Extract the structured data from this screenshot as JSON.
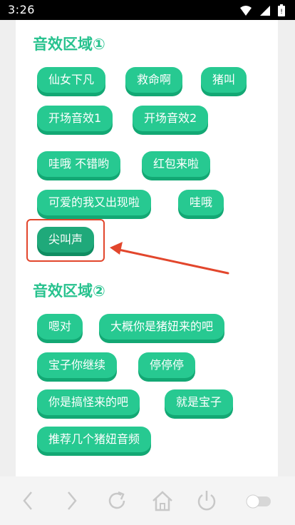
{
  "status_bar": {
    "time": "3:26",
    "icons": [
      "wifi-icon",
      "signal-icon",
      "battery-icon"
    ]
  },
  "sections": [
    {
      "title": "音效区域①",
      "buttons": [
        "仙女下凡",
        "救命啊",
        "猪叫",
        "开场音效1",
        "开场音效2",
        "哇哦 不错哟",
        "红包来啦",
        "可爱的我又出现啦",
        "哇哦",
        "尖叫声"
      ]
    },
    {
      "title": "音效区域②",
      "buttons": [
        "嗯对",
        "大概你是猪妞来的吧",
        "宝子你继续",
        "停停停",
        "你是搞怪来的吧",
        "就是宝子",
        "推荐几个猪妞音频"
      ]
    }
  ],
  "highlighted_button": "尖叫声",
  "colors": {
    "accent": "#27c991",
    "title": "#27c28e",
    "highlight": "#e2462c"
  },
  "bottom_nav": [
    "back-icon",
    "forward-icon",
    "reload-icon",
    "home-icon",
    "power-icon",
    "toggle-switch"
  ]
}
